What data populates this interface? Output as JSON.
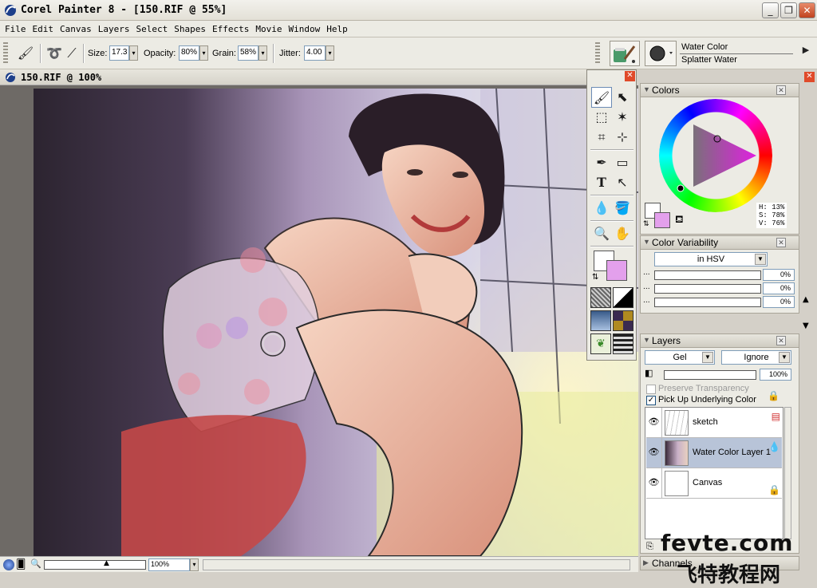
{
  "window": {
    "title": "Corel Painter 8 - [150.RIF @ 55%]"
  },
  "menu": [
    "File",
    "Edit",
    "Canvas",
    "Layers",
    "Select",
    "Shapes",
    "Effects",
    "Movie",
    "Window",
    "Help"
  ],
  "property_bar": {
    "size_label": "Size:",
    "size_value": "17.3",
    "opacity_label": "Opacity:",
    "opacity_value": "80%",
    "grain_label": "Grain:",
    "grain_value": "58%",
    "jitter_label": "Jitter:",
    "jitter_value": "4.00",
    "brush_category": "Water Color",
    "brush_variant": "Splatter Water"
  },
  "document": {
    "title": "150.RIF @ 100%",
    "zoom": "100%"
  },
  "colors_panel": {
    "title": "Colors",
    "h": "H: 13%",
    "s": "S: 78%",
    "v": "V: 76%",
    "main_color": "#ffffff",
    "additional_color": "#e3a0ec"
  },
  "color_variability": {
    "title": "Color Variability",
    "mode": "in HSV",
    "values": [
      "0%",
      "0%",
      "0%"
    ]
  },
  "layers_panel": {
    "title": "Layers",
    "composite_method": "Gel",
    "composite_depth": "Ignore",
    "opacity": "100%",
    "preserve_transparency": "Preserve Transparency",
    "pick_up_underlying": "Pick Up Underlying Color",
    "layers": [
      {
        "name": "sketch"
      },
      {
        "name": "Water Color Layer 1"
      },
      {
        "name": "Canvas"
      }
    ]
  },
  "channels_panel": {
    "title": "Channels"
  },
  "watermark": {
    "text": "fevte.com",
    "subtext": "飞特教程网"
  }
}
